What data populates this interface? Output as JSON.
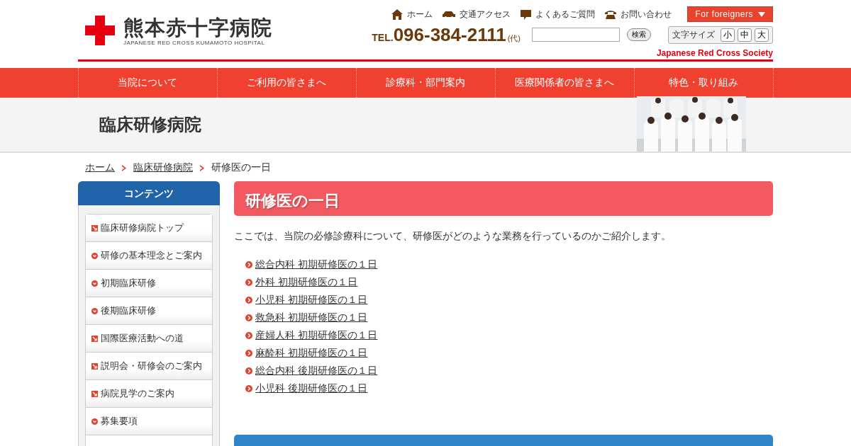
{
  "logo": {
    "name": "熊本赤十字病院",
    "subtitle": "JAPANESE RED CROSS KUMAMOTO HOSPITAL"
  },
  "top_links": [
    {
      "label": "ホーム",
      "kind": "home"
    },
    {
      "label": "交通アクセス",
      "kind": "access"
    },
    {
      "label": "よくあるご質問",
      "kind": "faq"
    },
    {
      "label": "お問い合わせ",
      "kind": "contact"
    }
  ],
  "language_button": "For foreigners",
  "phone": {
    "prefix": "TEL.",
    "number": "096-384-2111",
    "note": "(代)"
  },
  "search": {
    "button": "検索"
  },
  "font_size": {
    "label": "文字サイズ",
    "options": [
      "小",
      "中",
      "大"
    ]
  },
  "society": "Japanese Red Cross Society",
  "nav": [
    "当院について",
    "ご利用の皆さまへ",
    "診療科・部門案内",
    "医療関係者の皆さまへ",
    "特色・取り組み"
  ],
  "page_band": {
    "title": "臨床研修病院"
  },
  "breadcrumb": [
    {
      "label": "ホーム",
      "link": true
    },
    {
      "label": "臨床研修病院",
      "link": true
    },
    {
      "label": "研修医の一日",
      "link": false
    }
  ],
  "sidebar": {
    "title": "コンテンツ",
    "items": [
      {
        "label": "臨床研修病院トップ",
        "kind": "page"
      },
      {
        "label": "研修の基本理念とご案内",
        "kind": "section"
      },
      {
        "label": "初期臨床研修",
        "kind": "section"
      },
      {
        "label": "後期臨床研修",
        "kind": "section"
      },
      {
        "label": "国際医療活動への道",
        "kind": "page"
      },
      {
        "label": "説明会・研修会のご案内",
        "kind": "page"
      },
      {
        "label": "病院見学のご案内",
        "kind": "page"
      },
      {
        "label": "募集要項",
        "kind": "section"
      }
    ]
  },
  "content": {
    "title": "研修医の一日",
    "intro": "ここでは、当院の必修診療科について、研修医がどのような業務を行っているのかご紹介します。",
    "links": [
      "総合内科 初期研修医の１日",
      "外科 初期研修医の１日",
      "小児科 初期研修医の１日",
      "救急科 初期研修医の１日",
      "産婦人科 初期研修医の１日",
      "麻酔科 初期研修医の１日",
      "総合内科 後期研修医の１日",
      "小児科 後期研修医の１日"
    ]
  }
}
